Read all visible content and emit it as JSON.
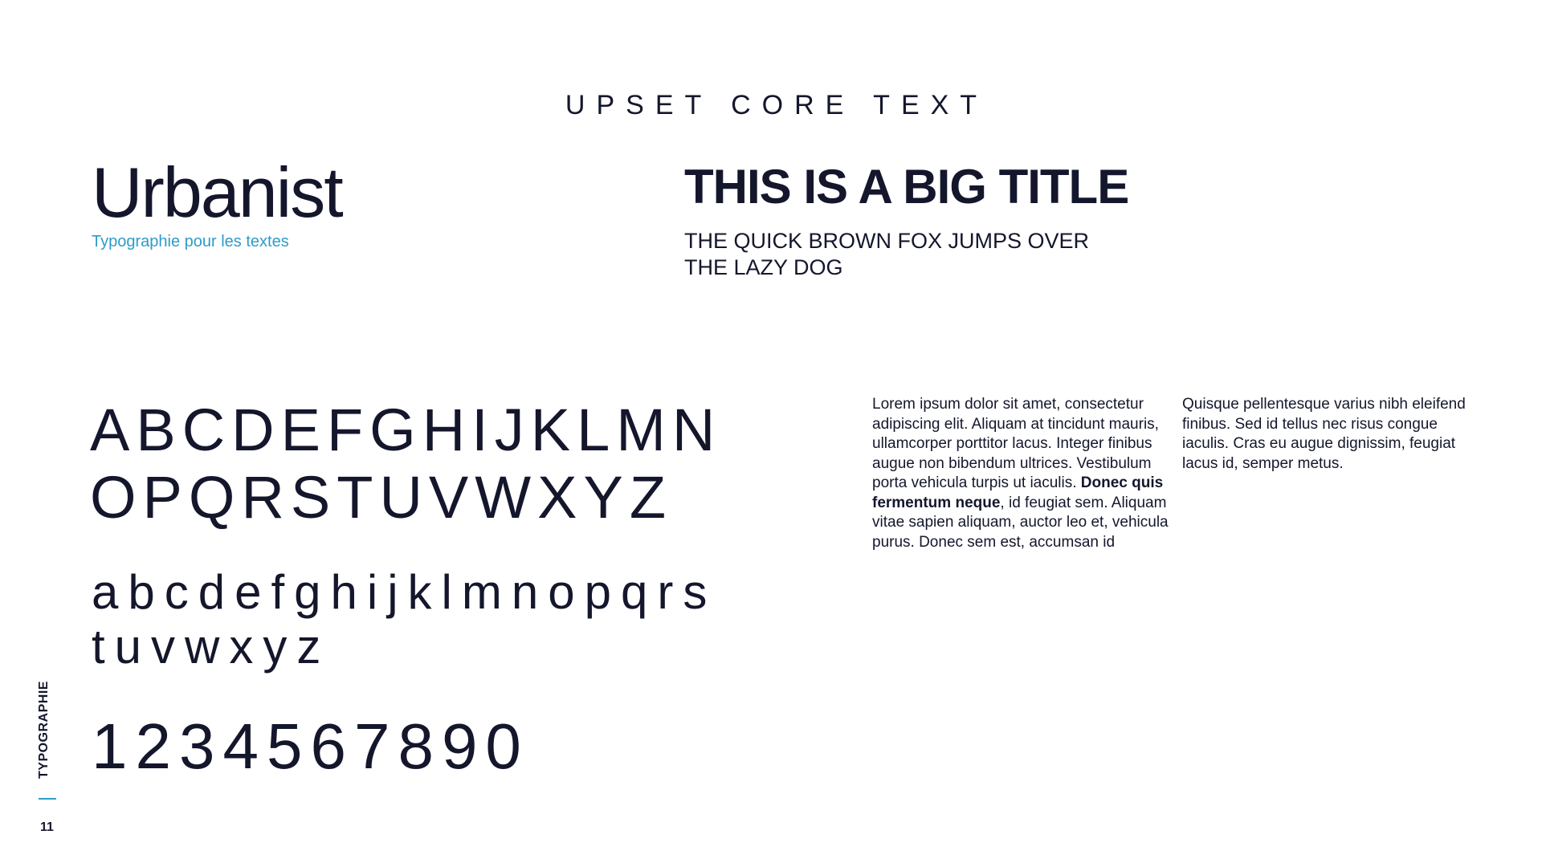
{
  "header": {
    "title": "UPSET CORE TEXT"
  },
  "font": {
    "name": "Urbanist",
    "description": "Typographie pour les textes"
  },
  "sample": {
    "big_title": "THIS IS A BIG TITLE",
    "subtitle": "THE QUICK BROWN FOX JUMPS OVER THE LAZY DOG"
  },
  "glyphs": {
    "uppercase_line_1": "ABCDEFGHIJKLMN",
    "uppercase_line_2": "OPQRSTUVWXYZ",
    "lowercase_line_1": "abcdefghijklmnopqrs",
    "lowercase_line_2": "tuvwxyz",
    "digits": "1234567890"
  },
  "body_text": {
    "column_1_before_bold": "Lorem ipsum dolor sit amet, consectetur adipiscing elit. Aliquam at tincidunt mauris, ullamcorper porttitor lacus. Integer finibus augue non bibendum ultrices. Vestibulum porta vehicula turpis ut iaculis. ",
    "column_1_bold": "Donec quis fermentum neque",
    "column_1_after_bold": ", id feugiat sem. Aliquam vitae sapien aliquam, auctor leo et, vehicula purus. Donec sem est, accumsan id",
    "column_2": "Quisque pellentesque varius nibh eleifend finibus. Sed id tellus nec risus congue iaculis. Cras eu augue dignissim, feugiat lacus id, semper metus."
  },
  "sidebar": {
    "section_label": "TYPOGRAPHIE",
    "page_number": "11"
  },
  "colors": {
    "text": "#14172c",
    "accent": "#2f9bc9",
    "background": "#ffffff"
  }
}
